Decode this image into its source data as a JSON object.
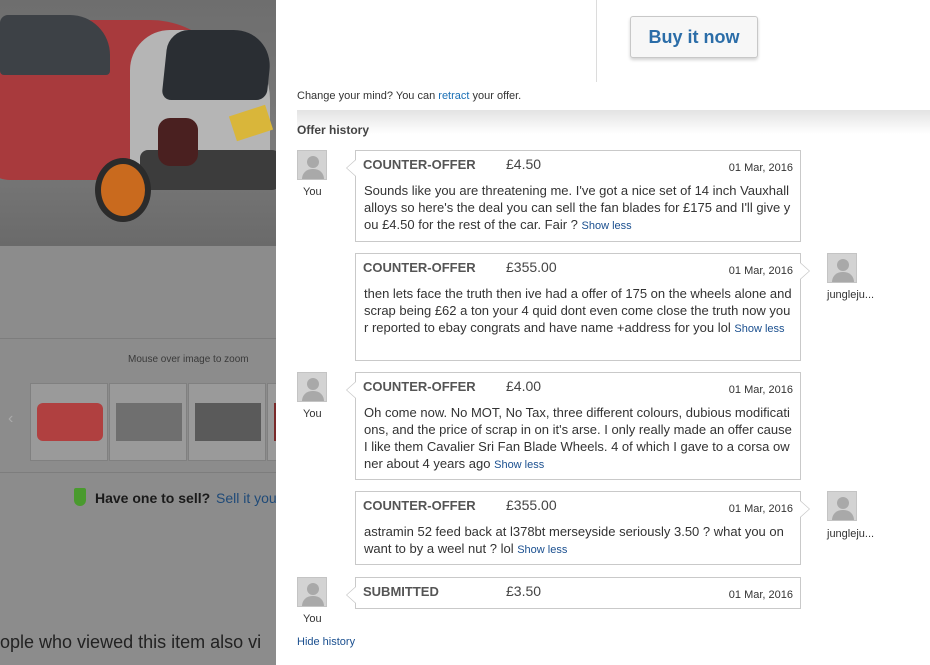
{
  "listing": {
    "zoom_hint": "Mouse over image to zoom",
    "sell_label": "Have one to sell?",
    "sell_link": "Sell it you",
    "also_viewed": "ople who viewed this item also vi",
    "prev_arrow": "‹"
  },
  "panel": {
    "buy_button": "Buy it now",
    "retract": {
      "prefix": "Change your mind? You can ",
      "link": "retract",
      "suffix": " your offer."
    },
    "history_title": "Offer history",
    "hide_history": "Hide history",
    "show_less": "Show less",
    "offers": [
      {
        "who": "You",
        "type": "COUNTER-OFFER",
        "amount": "£4.50",
        "date": "01 Mar, 2016",
        "message": "Sounds like you are threatening me. I've got a nice set of 14 inch Vauxhall alloys so here's the deal you can sell the fan blades for £175 and I'll give you £4.50 for the rest of the car. Fair ?"
      },
      {
        "who": "jungleju...",
        "type": "COUNTER-OFFER",
        "amount": "£355.00",
        "date": "01 Mar, 2016",
        "message": "then lets face the truth then ive had a offer of 175 on the wheels alone and scrap being £62 a ton your 4 quid dont even come close the truth now your reported to ebay congrats and have name +address for you lol"
      },
      {
        "who": "You",
        "type": "COUNTER-OFFER",
        "amount": "£4.00",
        "date": "01 Mar, 2016",
        "message": "Oh come now. No MOT, No Tax, three different colours, dubious modifications, and the price of scrap in on it's arse. I only really made an offer cause I like them Cavalier Sri Fan Blade Wheels. 4 of which I gave to a corsa owner about 4 years ago"
      },
      {
        "who": "jungleju...",
        "type": "COUNTER-OFFER",
        "amount": "£355.00",
        "date": "01 Mar, 2016",
        "message": "astramin 52 feed back at l378bt merseyside seriously 3.50 ? what you on want to by a weel nut ? lol"
      },
      {
        "who": "You",
        "type": "SUBMITTED",
        "amount": "£3.50",
        "date": "01 Mar, 2016",
        "message": ""
      }
    ]
  },
  "colors": {
    "link_blue": "#1a6fb5",
    "buy_text": "#2b6da8",
    "overlay_gray": "#8c8c8c"
  }
}
